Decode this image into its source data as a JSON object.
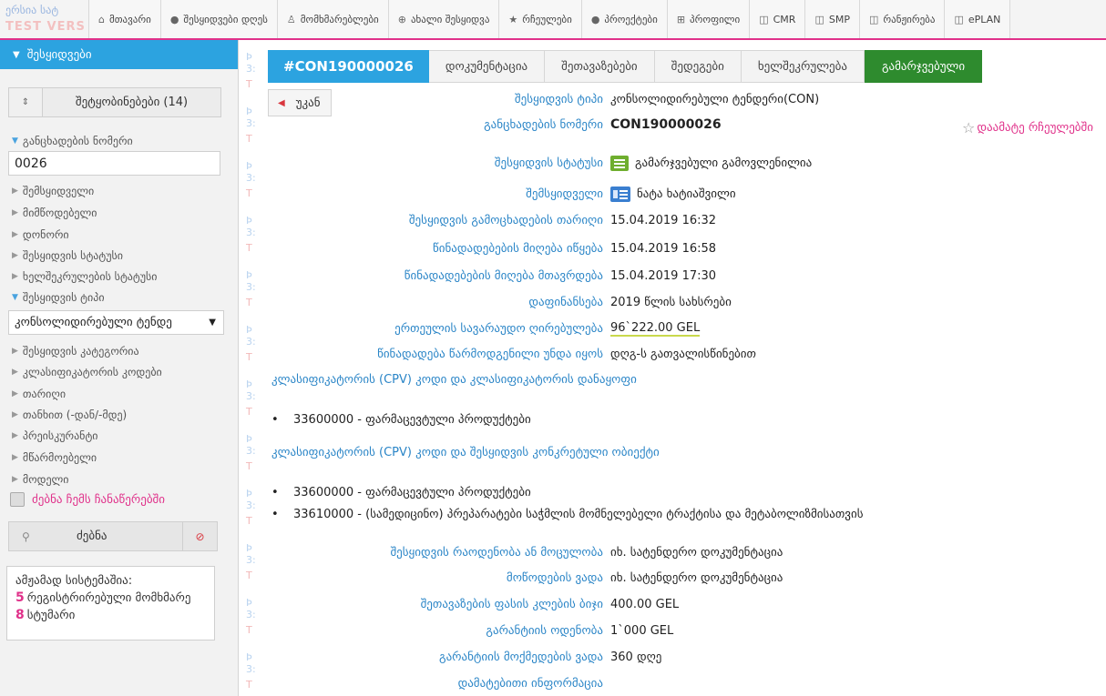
{
  "top": {
    "logo_line1": "ერსია  სატ",
    "logo_line2": "TEST VERS",
    "nav": [
      {
        "icon": "⌂",
        "icon_name": "home-icon",
        "label": "მთავარი"
      },
      {
        "icon": "●",
        "icon_name": "clock-icon",
        "label": "შესყიდვები დღეს"
      },
      {
        "icon": "♙",
        "icon_name": "user-icon",
        "label": "მომხმარებლები"
      },
      {
        "icon": "⊕",
        "icon_name": "plus-circle-icon",
        "label": "ახალი შესყიდვა"
      },
      {
        "icon": "★",
        "icon_name": "star-icon",
        "label": "რჩეულები"
      },
      {
        "icon": "●",
        "icon_name": "folder-icon",
        "label": "პროექტები"
      },
      {
        "icon": "⊞",
        "icon_name": "profile-icon",
        "label": "პროფილი"
      },
      {
        "icon": "◫",
        "icon_name": "link-icon",
        "label": "CMR"
      },
      {
        "icon": "◫",
        "icon_name": "link-icon",
        "label": "SMP"
      },
      {
        "icon": "◫",
        "icon_name": "link-icon",
        "label": "რანჟირება"
      },
      {
        "icon": "◫",
        "icon_name": "link-icon",
        "label": "ePLAN"
      }
    ]
  },
  "sidebar": {
    "title": "შესყიდვები",
    "notifications_label": "შეტყობინებები (14)",
    "filters": {
      "app_number": "განცხადების ნომერი",
      "app_number_value": "0026",
      "buyer": "შემსყიდველი",
      "supplier": "მიმწოდებელი",
      "dongori": "დონორი",
      "purchase_status": "შესყიდვის სტატუსი",
      "contract_status": "ხელშეკრულების სტატუსი",
      "purchase_type": "შესყიდვის ტიპი",
      "purchase_type_value": "კონსოლიდირებული ტენდე",
      "category": "შესყიდვის კატეგორია",
      "cpv_codes": "კლასიფიკატორის კოდები",
      "date": "თარიღი",
      "amount": "თანხით (-დან/-მდე)",
      "pre_qual": "პრეისკურანტი",
      "producer": "მწარმოებელი",
      "model": "მოდელი"
    },
    "my_records_label": "ძებნა ჩემს ჩანაწერებში",
    "search_label": "ძებნა",
    "online_title": "ამჟამად სისტემაშია:",
    "online_users_count": "5",
    "online_users_label": "რეგისტრირებული მომხმარე",
    "online_guests_count": "8",
    "online_guests_label": "სტუმარი"
  },
  "watermark": {
    "blue": "Þ 3:",
    "red": "T"
  },
  "tabs": {
    "items": [
      "#CON190000026",
      "დოკუმენტაცია",
      "შეთავაზებები",
      "შედეგები",
      "ხელშეკრულება",
      "გამარჯვებული"
    ]
  },
  "detail": {
    "back_label": "უკან",
    "favorite_label": "დაამატე რჩეულებში",
    "type_label": "შესყიდვის ტიპი",
    "type_value": "კონსოლიდირებული ტენდერი(CON)",
    "number_label": "განცხადების ნომერი",
    "number_value": "CON190000026",
    "status_label": "შესყიდვის სტატუსი",
    "status_value": "გამარჯვებული გამოვლენილია",
    "buyer_label": "შემსყიდველი",
    "buyer_value": "ნატა ხატიაშვილი",
    "announce_label": "შესყიდვის გამოცხადების თარიღი",
    "announce_value": "15.04.2019 16:32",
    "offers_start_label": "წინადადებების მიღება იწყება",
    "offers_start_value": "15.04.2019 16:58",
    "offers_end_label": "წინადადებების მიღება მთავრდება",
    "offers_end_value": "15.04.2019 17:30",
    "funding_label": "დაფინანსება",
    "funding_value": "2019 წლის სახსრები",
    "estimated_label": "ერთეულის სავარაუდო ღირებულება",
    "estimated_value": "96`222.00 GEL",
    "offer_form_label": "წინადადება წარმოდგენილი უნდა იყოს",
    "offer_form_value": "დღგ-ს გათვალისწინებით",
    "cpv_section_label": "კლასიფიკატორის (CPV) კოდი და კლასიფიკატორის დანაყოფი",
    "cpv_section_items": [
      "33600000 - ფარმაცევტული პროდუქტები"
    ],
    "cpv_object_label": "კლასიფიკატორის (CPV) კოდი და შესყიდვის კონკრეტული ობიექტი",
    "cpv_object_items": [
      "33600000 - ფარმაცევტული პროდუქტები",
      "33610000 - (სამედიცინო) პრეპარატები საჭმლის მომნელებელი ტრაქტისა და მეტაბოლიზმისათვის"
    ],
    "quantity_label": "შესყიდვის რაოდენობა ან მოცულობა",
    "quantity_value": "იხ. სატენდერო დოკუმენტაცია",
    "delivery_label": "მოწოდების ვადა",
    "delivery_value": "იხ. სატენდერო დოკუმენტაცია",
    "step_label": "შეთავაზების ფასის კლების ბიჯი",
    "step_value": "400.00 GEL",
    "guarantee_label": "გარანტიის ოდენობა",
    "guarantee_value": "1`000 GEL",
    "guarantee_term_label": "გარანტიის მოქმედების ვადა",
    "guarantee_term_value": "360 დღე",
    "extra_info_label": "დამატებითი ინფორმაცია"
  },
  "colors": {
    "accent_blue": "#2ca3e0",
    "winner_green": "#2e8b2e",
    "link_blue": "#2a85c7",
    "pink": "#e0318a"
  }
}
